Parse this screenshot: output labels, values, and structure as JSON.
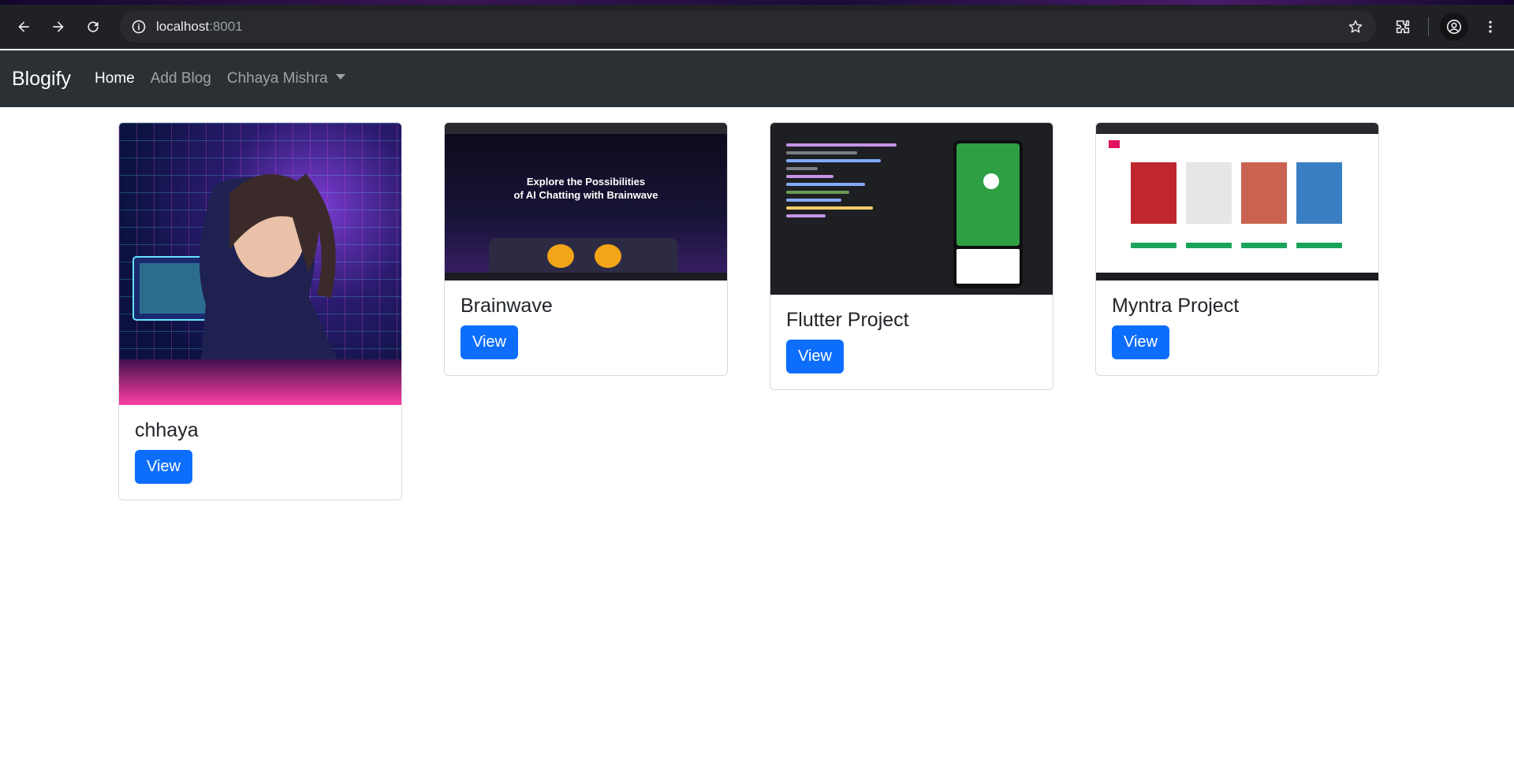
{
  "browser": {
    "url_host": "localhost",
    "url_port": ":8001"
  },
  "navbar": {
    "brand": "Blogify",
    "links": [
      {
        "label": "Home",
        "active": true
      },
      {
        "label": "Add Blog",
        "active": false
      }
    ],
    "user_menu": "Chhaya Mishra"
  },
  "cards": [
    {
      "title": "chhaya",
      "button": "View"
    },
    {
      "title": "Brainwave",
      "button": "View"
    },
    {
      "title": "Flutter Project",
      "button": "View"
    },
    {
      "title": "Myntra Project",
      "button": "View"
    }
  ],
  "thumbs": {
    "brainwave_headline_1": "Explore the Possibilities",
    "brainwave_headline_2": "of AI Chatting with Brainwave"
  },
  "colors": {
    "navbar_bg": "#2b3035",
    "primary_button": "#0d6efd",
    "browser_bar": "#202124"
  }
}
